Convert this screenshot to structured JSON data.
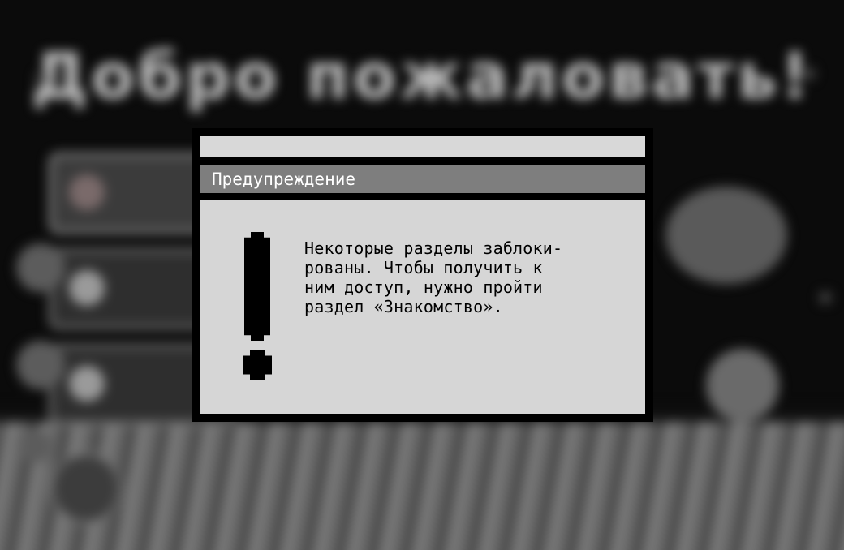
{
  "background": {
    "title": "Добро пожаловать!"
  },
  "dialog": {
    "title": "Предупреждение",
    "message": "Некоторые разделы заблоки-\nрованы. Чтобы получить к\nним доступ, нужно пройти\nраздел «Знакомство».",
    "icon": "exclamation-icon"
  },
  "colors": {
    "titlebar": "#7e7e7e",
    "body": "#d6d6d6",
    "border": "#000000",
    "top_strip": "#d8d8d8"
  }
}
